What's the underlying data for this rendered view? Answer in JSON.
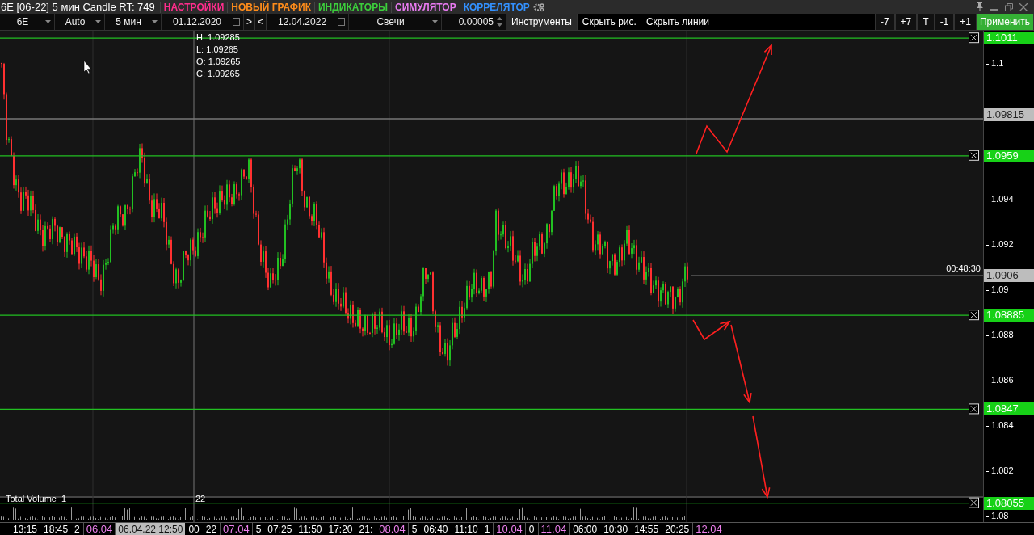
{
  "title": "6E [06-22] 5 мин Candle RT: 749",
  "menu": [
    {
      "label": "НАСТРОЙКИ",
      "color": "#ff2d8c"
    },
    {
      "label": "НОВЫЙ ГРАФИК",
      "color": "#ff8c1a"
    },
    {
      "label": "ИНДИКАТОРЫ",
      "color": "#3ccf3c"
    },
    {
      "label": "СИМУЛЯТОР",
      "color": "#e87af0"
    },
    {
      "label": "КОРРЕЛЯТОР",
      "color": "#3391ff"
    }
  ],
  "toolbar": {
    "symbol": "6E",
    "mode": "Auto",
    "timeframe": "5 мин",
    "date_from": "01.12.2020",
    "range_buttons": [
      ">",
      "<"
    ],
    "date_to": "12.04.2022",
    "chart_type": "Свечи",
    "step": "0.00005",
    "buttons": [
      "Инструменты",
      "Скрыть рис.",
      "Скрыть линии"
    ],
    "shift_buttons": [
      "-7",
      "+7",
      "T",
      "-1",
      "+1"
    ],
    "apply": "Применить"
  },
  "ohlc": [
    "H: 1.09285",
    "L: 1.09265",
    "O: 1.09265",
    "C: 1.09265"
  ],
  "price_ticks": [
    "1.1",
    "1.094",
    "1.092",
    "1.09",
    "1.088",
    "1.086",
    "1.084",
    "1.082",
    "1.08"
  ],
  "price_levels": [
    {
      "label": "1.1011",
      "kind": "level"
    },
    {
      "label": "1.09815",
      "kind": "marker"
    },
    {
      "label": "1.0959",
      "kind": "level"
    },
    {
      "label": "1.0906",
      "kind": "current",
      "timer": "00:48:30"
    },
    {
      "label": "1.08885",
      "kind": "level"
    },
    {
      "label": "1.0847",
      "kind": "level"
    },
    {
      "label": "1.08055",
      "kind": "level"
    }
  ],
  "volume_pane": {
    "title": "Total Volume_1",
    "value": "22"
  },
  "time_axis": [
    {
      "label": "13:15",
      "kind": "time"
    },
    {
      "label": "18:45",
      "kind": "time"
    },
    {
      "label": "2",
      "kind": "time"
    },
    {
      "label": "06.04",
      "kind": "date"
    },
    {
      "label": "06.04.22 12:50",
      "kind": "cursor"
    },
    {
      "label": "00",
      "kind": "time"
    },
    {
      "label": "22",
      "kind": "time"
    },
    {
      "label": "07.04",
      "kind": "date"
    },
    {
      "label": "5",
      "kind": "time"
    },
    {
      "label": "07:25",
      "kind": "time"
    },
    {
      "label": "11:50",
      "kind": "time"
    },
    {
      "label": "17:20",
      "kind": "time"
    },
    {
      "label": "21:",
      "kind": "time"
    },
    {
      "label": "08.04",
      "kind": "date"
    },
    {
      "label": "5",
      "kind": "time"
    },
    {
      "label": "06:40",
      "kind": "time"
    },
    {
      "label": "11:10",
      "kind": "time"
    },
    {
      "label": "1",
      "kind": "time"
    },
    {
      "label": "10.04",
      "kind": "date"
    },
    {
      "label": "0",
      "kind": "time"
    },
    {
      "label": "11.04",
      "kind": "date"
    },
    {
      "label": "06:00",
      "kind": "time"
    },
    {
      "label": "10:30",
      "kind": "time"
    },
    {
      "label": "14:55",
      "kind": "time"
    },
    {
      "label": "20:25",
      "kind": "time"
    },
    {
      "label": "12.04",
      "kind": "date"
    }
  ]
}
